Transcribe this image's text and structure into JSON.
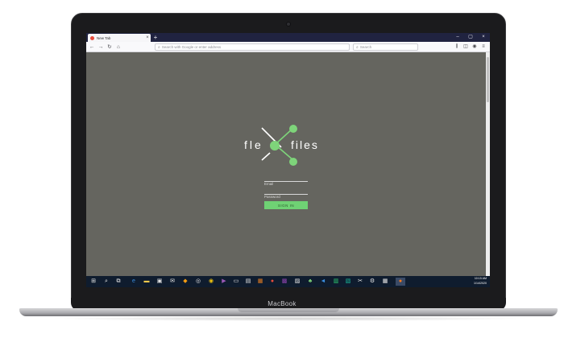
{
  "device": {
    "brand_label": "MacBook"
  },
  "browser": {
    "tab": {
      "title": "New Tab",
      "close_icon": "close-icon",
      "favicon_icon": "browser-favicon-icon"
    },
    "new_tab_icon": "plus-icon",
    "window_controls": [
      "minimize-icon",
      "maximize-icon",
      "close-icon"
    ],
    "toolbar": {
      "back_icon": "back-arrow-icon",
      "forward_icon": "forward-arrow-icon",
      "reload_icon": "reload-icon",
      "home_icon": "home-icon",
      "url_placeholder": "Search with Google or enter address",
      "search_placeholder": "Search",
      "right_icons": [
        "library-icon",
        "sidebar-icon",
        "account-icon",
        "menu-icon"
      ]
    }
  },
  "page": {
    "logo_text_left": "fle",
    "logo_text_right": "files",
    "logo_accent_color": "#7ed47a",
    "email_placeholder": "Email",
    "password_placeholder": "Password",
    "signin_label": "SIGN IN",
    "background_color": "#65655f"
  },
  "taskbar": {
    "items": [
      "windows-start-icon",
      "search-icon",
      "task-view-icon",
      "edge-browser-icon",
      "file-explorer-icon",
      "store-icon",
      "mail-icon",
      "app-icon",
      "photos-icon",
      "chrome-icon",
      "visual-studio-icon",
      "terminal-icon",
      "app-icon",
      "app-icon",
      "app-icon",
      "app-icon",
      "image-icon",
      "app-icon",
      "vscode-icon",
      "app-icon",
      "app-icon",
      "app-icon",
      "app-icon",
      "calculator-icon",
      "firefox-icon"
    ],
    "time": "10:15 AM",
    "date": "1/14/2020"
  }
}
